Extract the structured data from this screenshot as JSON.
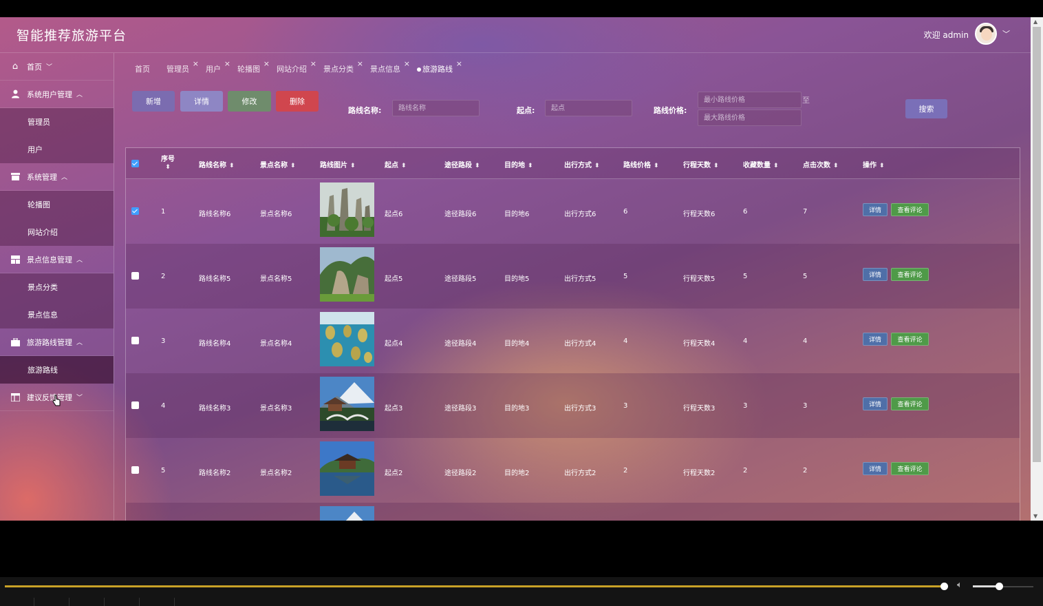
{
  "app": {
    "title": "智能推荐旅游平台",
    "welcome": "欢迎 admin"
  },
  "sidebar": {
    "home": "首页",
    "groups": [
      {
        "label": "系统用户管理",
        "icon": "user-icon",
        "items": [
          "管理员",
          "用户"
        ]
      },
      {
        "label": "系统管理",
        "icon": "settings-icon",
        "items": [
          "轮播图",
          "网站介绍"
        ]
      },
      {
        "label": "景点信息管理",
        "icon": "grid-icon",
        "items": [
          "景点分类",
          "景点信息"
        ]
      },
      {
        "label": "旅游路线管理",
        "icon": "briefcase-icon",
        "items": [
          "旅游路线"
        ]
      },
      {
        "label": "建议反馈管理",
        "icon": "table-icon",
        "items": []
      }
    ]
  },
  "tabs": [
    "首页",
    "管理员",
    "用户",
    "轮播图",
    "网站介绍",
    "景点分类",
    "景点信息",
    "旅游路线"
  ],
  "toolbar": {
    "add": "新增",
    "detail": "详情",
    "edit": "修改",
    "delete": "删除",
    "search": "搜索",
    "range_sep": "至"
  },
  "filters": {
    "route_name_label": "路线名称:",
    "route_name_placeholder": "路线名称",
    "origin_label": "起点:",
    "origin_placeholder": "起点",
    "price_label": "路线价格:",
    "min_price_placeholder": "最小路线价格",
    "max_price_placeholder": "最大路线价格"
  },
  "table": {
    "headers": [
      "序号",
      "路线名称",
      "景点名称",
      "路线图片",
      "起点",
      "途径路段",
      "目的地",
      "出行方式",
      "路线价格",
      "行程天数",
      "收藏数量",
      "点击次数",
      "操作"
    ],
    "action_detail": "详情",
    "action_comments": "查看评论",
    "rows": [
      {
        "no": "1",
        "route": "路线名称6",
        "spot": "景点名称6",
        "origin": "起点6",
        "via": "途径路段6",
        "dest": "目的地6",
        "mode": "出行方式6",
        "price": "6",
        "days": "行程天数6",
        "fav": "6",
        "clicks": "7",
        "checked": true
      },
      {
        "no": "2",
        "route": "路线名称5",
        "spot": "景点名称5",
        "origin": "起点5",
        "via": "途径路段5",
        "dest": "目的地5",
        "mode": "出行方式5",
        "price": "5",
        "days": "行程天数5",
        "fav": "5",
        "clicks": "5",
        "checked": false
      },
      {
        "no": "3",
        "route": "路线名称4",
        "spot": "景点名称4",
        "origin": "起点4",
        "via": "途径路段4",
        "dest": "目的地4",
        "mode": "出行方式4",
        "price": "4",
        "days": "行程天数4",
        "fav": "4",
        "clicks": "4",
        "checked": false
      },
      {
        "no": "4",
        "route": "路线名称3",
        "spot": "景点名称3",
        "origin": "起点3",
        "via": "途径路段3",
        "dest": "目的地3",
        "mode": "出行方式3",
        "price": "3",
        "days": "行程天数3",
        "fav": "3",
        "clicks": "3",
        "checked": false
      },
      {
        "no": "5",
        "route": "路线名称2",
        "spot": "景点名称2",
        "origin": "起点2",
        "via": "途径路段2",
        "dest": "目的地2",
        "mode": "出行方式2",
        "price": "2",
        "days": "行程天数2",
        "fav": "2",
        "clicks": "2",
        "checked": false
      }
    ]
  },
  "colors": {
    "add_btn": "#7b6cb0",
    "detail_btn": "#8e86c4",
    "edit_btn": "#6f8c6c",
    "delete_btn": "#d0464e",
    "search_btn": "#7a6fb8",
    "row_detail_btn": "#4f6fa8",
    "row_comment_btn": "#4f9a48",
    "checkbox_checked": "#409eff",
    "progress": "#c9a227"
  }
}
